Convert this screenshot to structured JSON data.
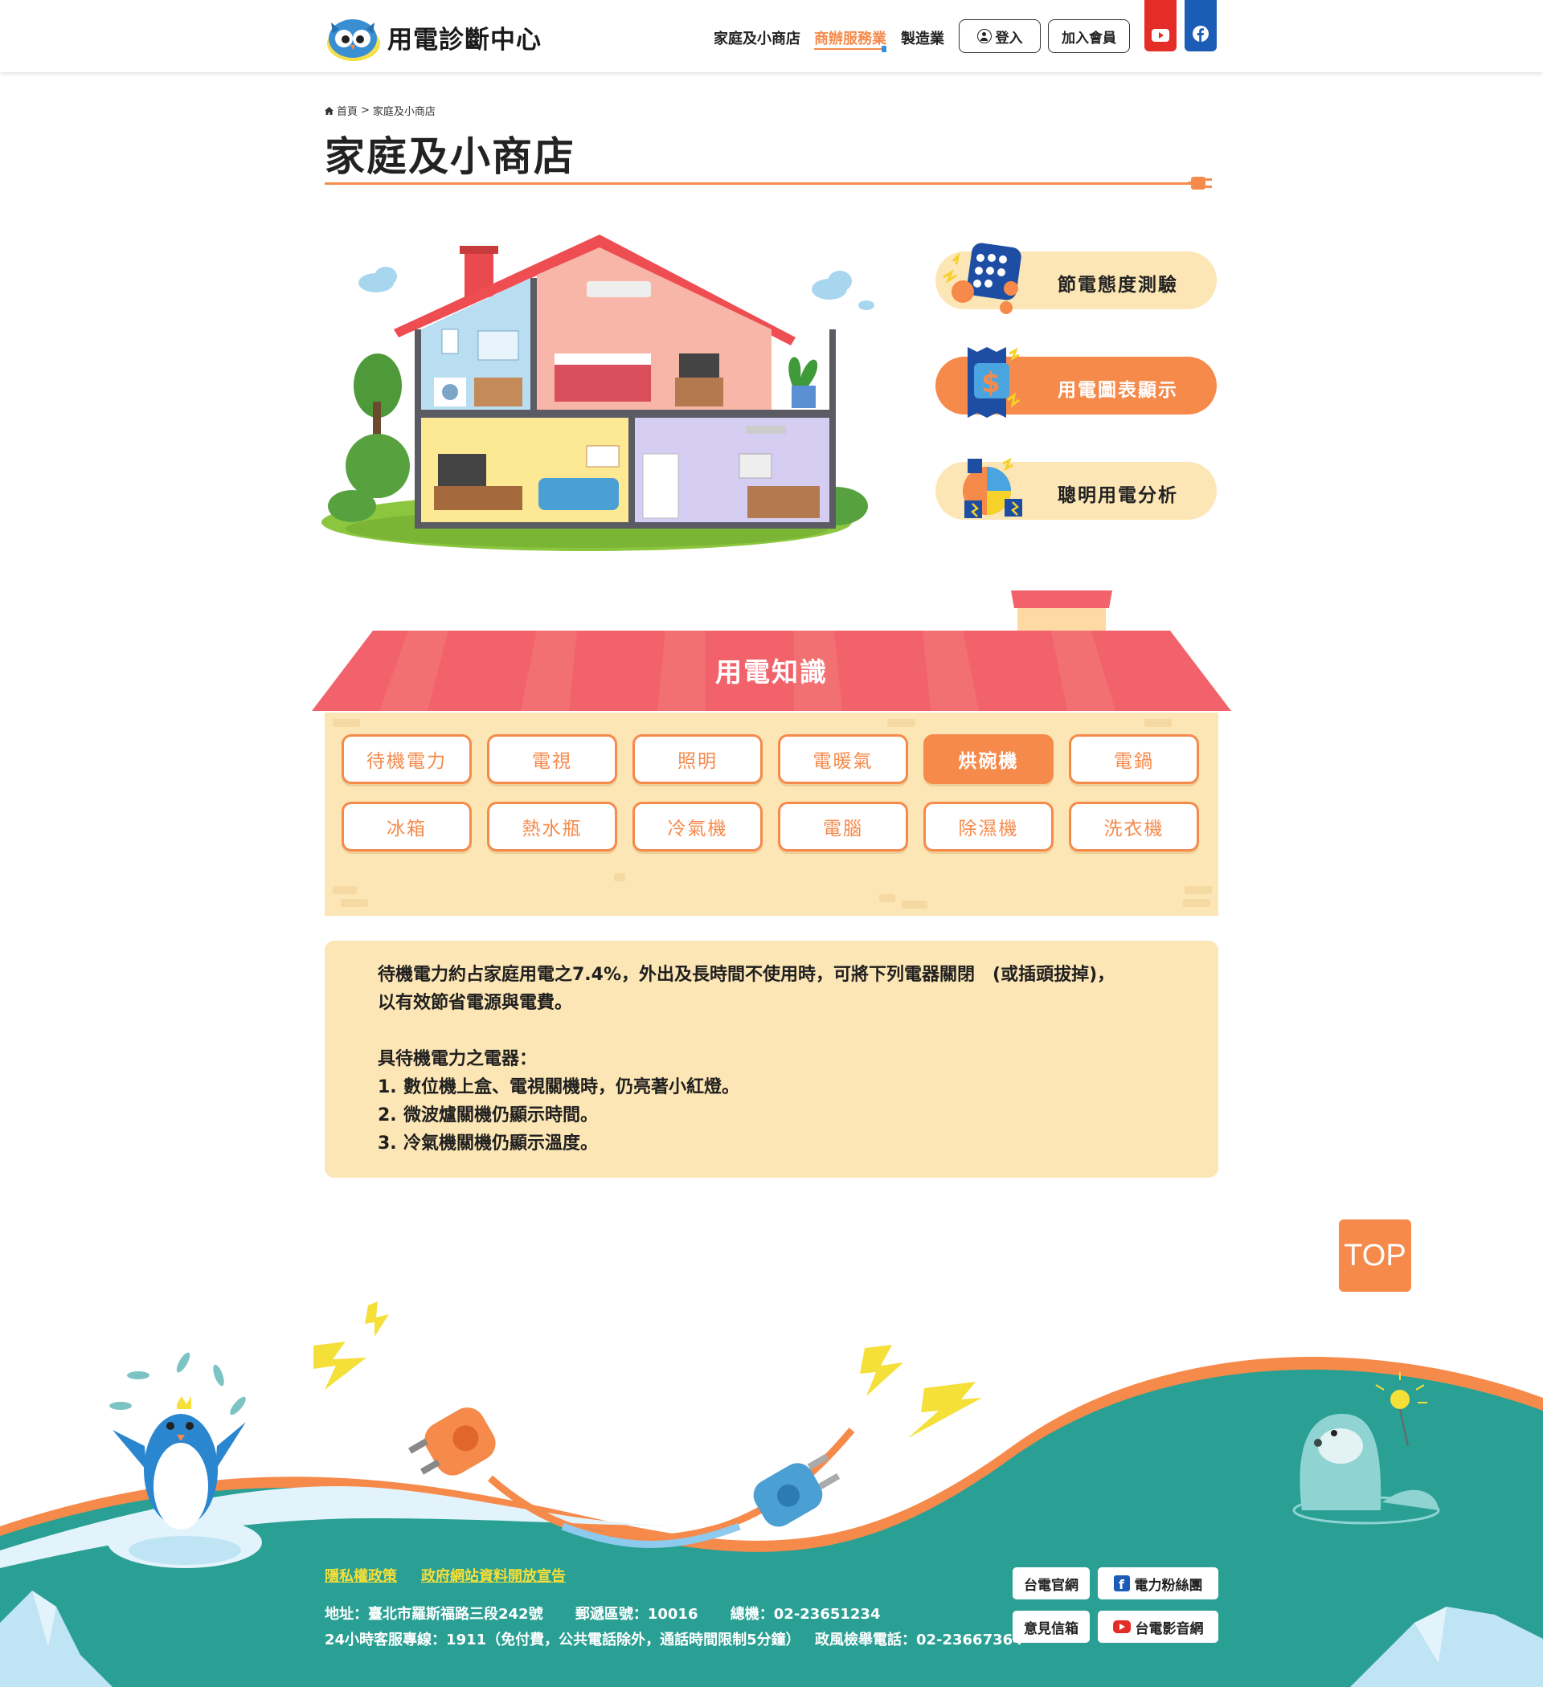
{
  "header": {
    "logo_text": "用電診斷中心",
    "nav": [
      {
        "label": "家庭及小商店"
      },
      {
        "label": "商辦服務業"
      },
      {
        "label": "製造業"
      }
    ],
    "login_label": "登入",
    "join_label": "加入會員"
  },
  "breadcrumb": {
    "home": "首頁",
    "separator": ">",
    "current": "家庭及小商店"
  },
  "page_title": "家庭及小商店",
  "features": [
    {
      "label": "節電態度測驗",
      "icon": "quiz-icon"
    },
    {
      "label": "用電圖表顯示",
      "icon": "chart-bill-icon"
    },
    {
      "label": "聰明用電分析",
      "icon": "analysis-icon"
    }
  ],
  "knowledge": {
    "title": "用電知識",
    "items": [
      "待機電力",
      "電視",
      "照明",
      "電暖氣",
      "烘碗機",
      "電鍋",
      "冰箱",
      "熱水瓶",
      "冷氣機",
      "電腦",
      "除濕機",
      "洗衣機"
    ],
    "active": "烘碗機"
  },
  "info": {
    "intro_1": "待機電力約占家庭用電之7.4%，外出及長時間不使用時，可將下列電器關閉　(或插頭拔掉)，",
    "intro_2": "以有效節省電源與電費。",
    "list_title": "具待機電力之電器：",
    "list": [
      {
        "num": "1.",
        "text": "數位機上盒、電視關機時，仍亮著小紅燈。"
      },
      {
        "num": "2.",
        "text": "微波爐關機仍顯示時間。"
      },
      {
        "num": "3.",
        "text": "冷氣機關機仍顯示溫度。"
      }
    ]
  },
  "top_label": "TOP",
  "footer": {
    "links": [
      "隱私權政策",
      "政府網站資料開放宣告"
    ],
    "address": "地址：臺北市羅斯福路三段242號",
    "zip": "郵遞區號：10016",
    "phone": "總機：02-23651234",
    "service": "24小時客服專線：1911（免付費，公共電話除外，通話時間限制5分鐘）",
    "report": "政風檢舉電話：02-23667364",
    "ext": {
      "taipower": "台電官網",
      "fans": "電力粉絲團",
      "mailbox": "意見信箱",
      "video": "台電影音網"
    }
  },
  "colors": {
    "accent": "#f58a4b",
    "cream": "#fde6b5",
    "teal": "#2aa094",
    "roof_red": "#f2626a"
  }
}
